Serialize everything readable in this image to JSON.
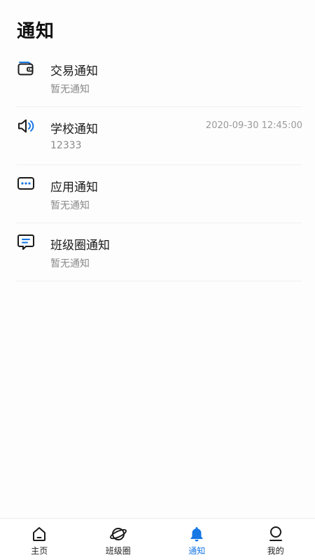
{
  "page": {
    "title": "通知"
  },
  "notices": [
    {
      "title": "交易通知",
      "subtitle": "暂无通知",
      "time": "",
      "icon": "wallet-icon"
    },
    {
      "title": "学校通知",
      "subtitle": "12333",
      "time": "2020-09-30 12:45:00",
      "icon": "speaker-icon"
    },
    {
      "title": "应用通知",
      "subtitle": "暂无通知",
      "time": "",
      "icon": "message-dots-icon"
    },
    {
      "title": "班级圈通知",
      "subtitle": "暂无通知",
      "time": "",
      "icon": "chat-bubble-icon"
    }
  ],
  "tabbar": {
    "items": [
      {
        "label": "主页",
        "icon": "home-icon",
        "active": false
      },
      {
        "label": "班级圈",
        "icon": "planet-icon",
        "active": false
      },
      {
        "label": "通知",
        "icon": "bell-icon",
        "active": true
      },
      {
        "label": "我的",
        "icon": "user-icon",
        "active": false
      }
    ]
  },
  "colors": {
    "accent": "#1677e5",
    "text": "#1a1a1a",
    "subtext": "#8a8a8a"
  }
}
